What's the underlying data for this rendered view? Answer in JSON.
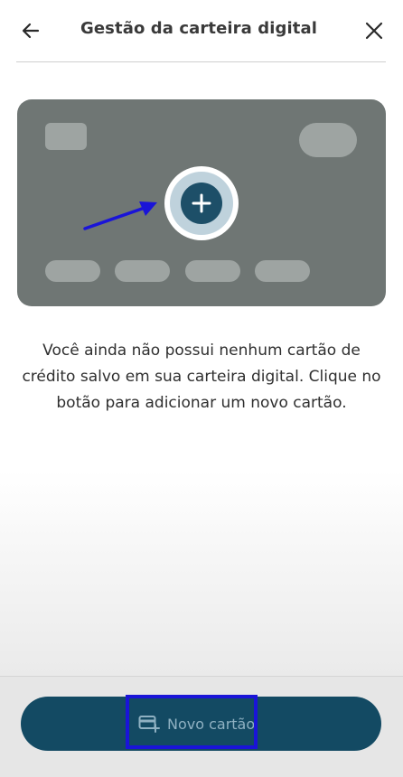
{
  "header": {
    "title": "Gestão da carteira digital",
    "back_icon": "arrow-left-icon",
    "close_icon": "close-icon"
  },
  "card_illustration": {
    "add_icon": "plus-icon",
    "card_color": "#6f7674",
    "accent_color": "#1d4f68"
  },
  "empty_state": {
    "message": "Você ainda não possui nenhum cartão de crédito salvo em sua carteira digital. Clique no botão para adicionar um novo cartão."
  },
  "footer": {
    "new_card_label": "Novo cartão",
    "new_card_icon": "add-card-icon",
    "button_color": "#134a63"
  }
}
